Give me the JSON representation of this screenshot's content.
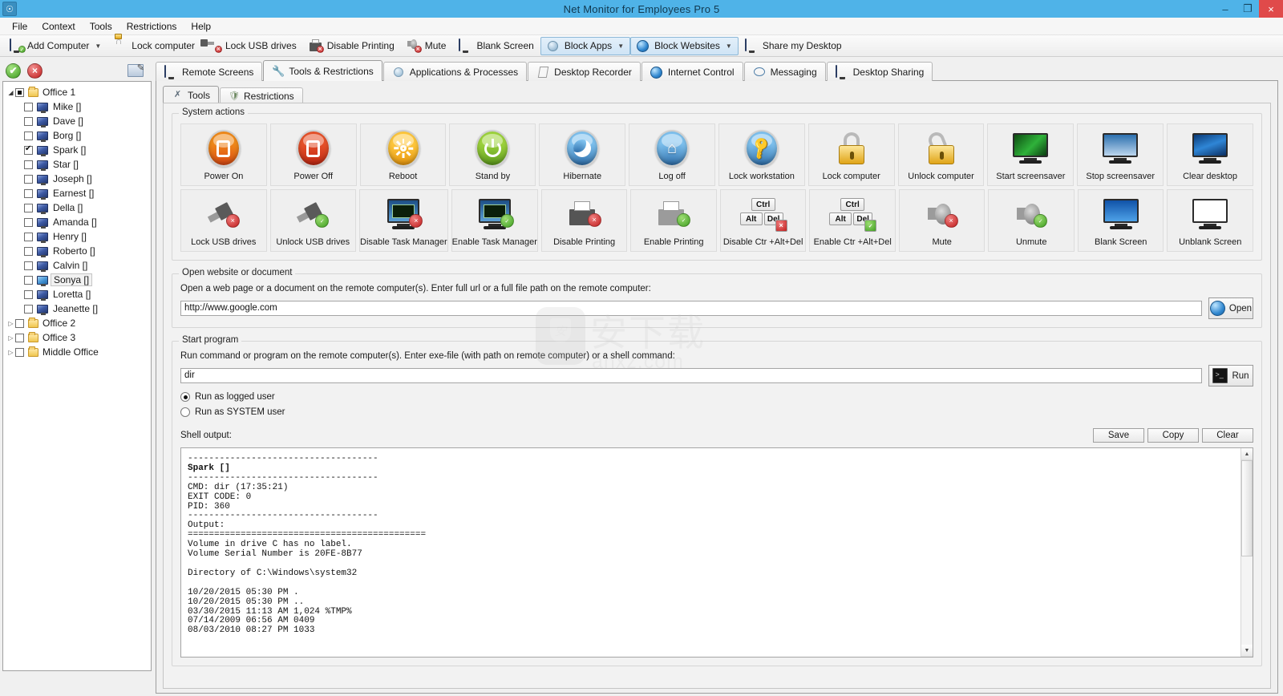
{
  "window": {
    "title": "Net Monitor for Employees Pro 5",
    "app_icon": "app-icon",
    "minimize": "–",
    "maximize": "❐",
    "close": "×"
  },
  "menu": {
    "items": [
      "File",
      "Context",
      "Tools",
      "Restrictions",
      "Help"
    ]
  },
  "toolbar": {
    "items": [
      {
        "label": "Add Computer",
        "icon": "add-computer-icon",
        "caret": "▼",
        "active": false
      },
      {
        "label": "Lock computer",
        "icon": "lock-icon",
        "active": false
      },
      {
        "label": "Lock USB drives",
        "icon": "usb-lock-icon",
        "active": false
      },
      {
        "label": "Disable Printing",
        "icon": "printer-disable-icon",
        "active": false
      },
      {
        "label": "Mute",
        "icon": "mute-icon",
        "active": false
      },
      {
        "label": "Blank Screen",
        "icon": "blank-screen-icon",
        "active": false
      },
      {
        "label": "Block Apps",
        "icon": "block-apps-icon",
        "caret": "▼",
        "active": true
      },
      {
        "label": "Block Websites",
        "icon": "block-websites-icon",
        "caret": "▼",
        "active": true
      },
      {
        "label": "Share my Desktop",
        "icon": "share-desktop-icon",
        "active": false
      }
    ]
  },
  "sidebar": {
    "accept_button": "✔",
    "reject_button": "×",
    "edit_button": "edit-icon",
    "tree": [
      {
        "label": "Office 1",
        "type": "folder",
        "expanded": true,
        "checkbox": "partial",
        "arrow": "◢"
      },
      {
        "label": "Mike []",
        "type": "computer",
        "checkbox": "unchecked"
      },
      {
        "label": "Dave []",
        "type": "computer",
        "checkbox": "unchecked"
      },
      {
        "label": "Borg []",
        "type": "computer",
        "checkbox": "unchecked"
      },
      {
        "label": "Spark []",
        "type": "computer",
        "checkbox": "checked"
      },
      {
        "label": "Star []",
        "type": "computer",
        "checkbox": "unchecked"
      },
      {
        "label": "Joseph []",
        "type": "computer",
        "checkbox": "unchecked"
      },
      {
        "label": "Earnest  []",
        "type": "computer",
        "checkbox": "unchecked"
      },
      {
        "label": "Della []",
        "type": "computer",
        "checkbox": "unchecked"
      },
      {
        "label": "Amanda  []",
        "type": "computer",
        "checkbox": "unchecked"
      },
      {
        "label": "Henry  []",
        "type": "computer",
        "checkbox": "unchecked"
      },
      {
        "label": "Roberto  []",
        "type": "computer",
        "checkbox": "unchecked"
      },
      {
        "label": "Calvin  []",
        "type": "computer",
        "checkbox": "unchecked"
      },
      {
        "label": "Sonya []",
        "type": "computer",
        "checkbox": "unchecked",
        "selected": true
      },
      {
        "label": "Loretta  []",
        "type": "computer",
        "checkbox": "unchecked"
      },
      {
        "label": "Jeanette  []",
        "type": "computer",
        "checkbox": "unchecked"
      },
      {
        "label": "Office 2",
        "type": "folder",
        "expanded": false,
        "checkbox": "unchecked",
        "arrow": "▷"
      },
      {
        "label": "Office 3",
        "type": "folder",
        "expanded": false,
        "checkbox": "unchecked",
        "arrow": "▷"
      },
      {
        "label": "Middle Office",
        "type": "folder",
        "expanded": false,
        "checkbox": "unchecked",
        "arrow": "▷"
      }
    ]
  },
  "main": {
    "tabs": [
      {
        "label": "Remote Screens",
        "icon": "remote-screens-icon",
        "selected": false
      },
      {
        "label": "Tools & Restrictions",
        "icon": "tools-icon",
        "selected": true
      },
      {
        "label": "Applications & Processes",
        "icon": "applications-icon",
        "selected": false
      },
      {
        "label": "Desktop Recorder",
        "icon": "recorder-icon",
        "selected": false
      },
      {
        "label": "Internet Control",
        "icon": "internet-icon",
        "selected": false
      },
      {
        "label": "Messaging",
        "icon": "messaging-icon",
        "selected": false
      },
      {
        "label": "Desktop Sharing",
        "icon": "desktop-sharing-icon",
        "selected": false
      }
    ],
    "subtabs": [
      {
        "label": "Tools",
        "icon": "tools-wrench-icon",
        "selected": true
      },
      {
        "label": "Restrictions",
        "icon": "shield-icon",
        "selected": false
      }
    ],
    "system_actions": {
      "legend": "System actions",
      "row1": [
        {
          "label": "Power On",
          "icon": "power-on-icon"
        },
        {
          "label": "Power Off",
          "icon": "power-off-icon"
        },
        {
          "label": "Reboot",
          "icon": "reboot-icon"
        },
        {
          "label": "Stand by",
          "icon": "standby-icon"
        },
        {
          "label": "Hibernate",
          "icon": "hibernate-icon"
        },
        {
          "label": "Log off",
          "icon": "logoff-icon"
        },
        {
          "label": "Lock workstation",
          "icon": "lock-workstation-icon"
        },
        {
          "label": "Lock computer",
          "icon": "lock-computer-icon"
        },
        {
          "label": "Unlock computer",
          "icon": "unlock-computer-icon"
        },
        {
          "label": "Start screensaver",
          "icon": "start-screensaver-icon"
        },
        {
          "label": "Stop screensaver",
          "icon": "stop-screensaver-icon"
        },
        {
          "label": "Clear desktop",
          "icon": "clear-desktop-icon"
        }
      ],
      "row2": [
        {
          "label": "Lock USB drives",
          "icon": "lock-usb-icon"
        },
        {
          "label": "Unlock USB drives",
          "icon": "unlock-usb-icon"
        },
        {
          "label": "Disable Task Manager",
          "icon": "disable-task-manager-icon"
        },
        {
          "label": "Enable Task Manager",
          "icon": "enable-task-manager-icon"
        },
        {
          "label": "Disable Printing",
          "icon": "disable-printing-icon"
        },
        {
          "label": "Enable Printing",
          "icon": "enable-printing-icon"
        },
        {
          "label": "Disable Ctr +Alt+Del",
          "icon": "disable-ctrl-alt-del-icon",
          "keys": [
            "Ctrl",
            "Alt",
            "Del"
          ]
        },
        {
          "label": "Enable Ctr +Alt+Del",
          "icon": "enable-ctrl-alt-del-icon",
          "keys": [
            "Ctrl",
            "Alt",
            "Del"
          ]
        },
        {
          "label": "Mute",
          "icon": "mute-icon"
        },
        {
          "label": "Unmute",
          "icon": "unmute-icon"
        },
        {
          "label": "Blank Screen",
          "icon": "blank-screen-icon"
        },
        {
          "label": "Unblank Screen",
          "icon": "unblank-screen-icon"
        }
      ]
    },
    "open_website": {
      "legend": "Open website or document",
      "description": "Open a web page or a document on the remote computer(s). Enter full url or a full file path on the remote computer:",
      "url_value": "http://www.google.com",
      "open_button": "Open"
    },
    "start_program": {
      "legend": "Start program",
      "description": "Run command or program on the remote computer(s). Enter exe-file (with path on remote computer) or a shell command:",
      "command_value": "dir",
      "run_button": "Run",
      "radio_logged": "Run as logged user",
      "radio_system": "Run as SYSTEM user",
      "selected_radio": "logged"
    },
    "shell": {
      "label": "Shell output:",
      "save_button": "Save",
      "copy_button": "Copy",
      "clear_button": "Clear",
      "header_divider": "------------------------------------",
      "target": "Spark []",
      "cmd_line": "CMD: dir (17:35:21)",
      "exit_code": "EXIT CODE: 0",
      "pid": "PID: 360",
      "output_label": "Output:",
      "output_divider": "=============================================",
      "lines": [
        "Volume in drive C has no label.",
        "Volume Serial Number is 20FE-8B77",
        "",
        "Directory of C:\\Windows\\system32",
        "",
        "10/20/2015 05:30 PM .",
        "10/20/2015 05:30 PM ..",
        "03/30/2015 11:13 AM 1,024 %TMP%",
        "07/14/2009 06:56 AM 0409",
        "08/03/2010 08:27 PM 1033"
      ]
    }
  },
  "watermark": {
    "cn_text": "安下载",
    "site": "anxz.com"
  }
}
